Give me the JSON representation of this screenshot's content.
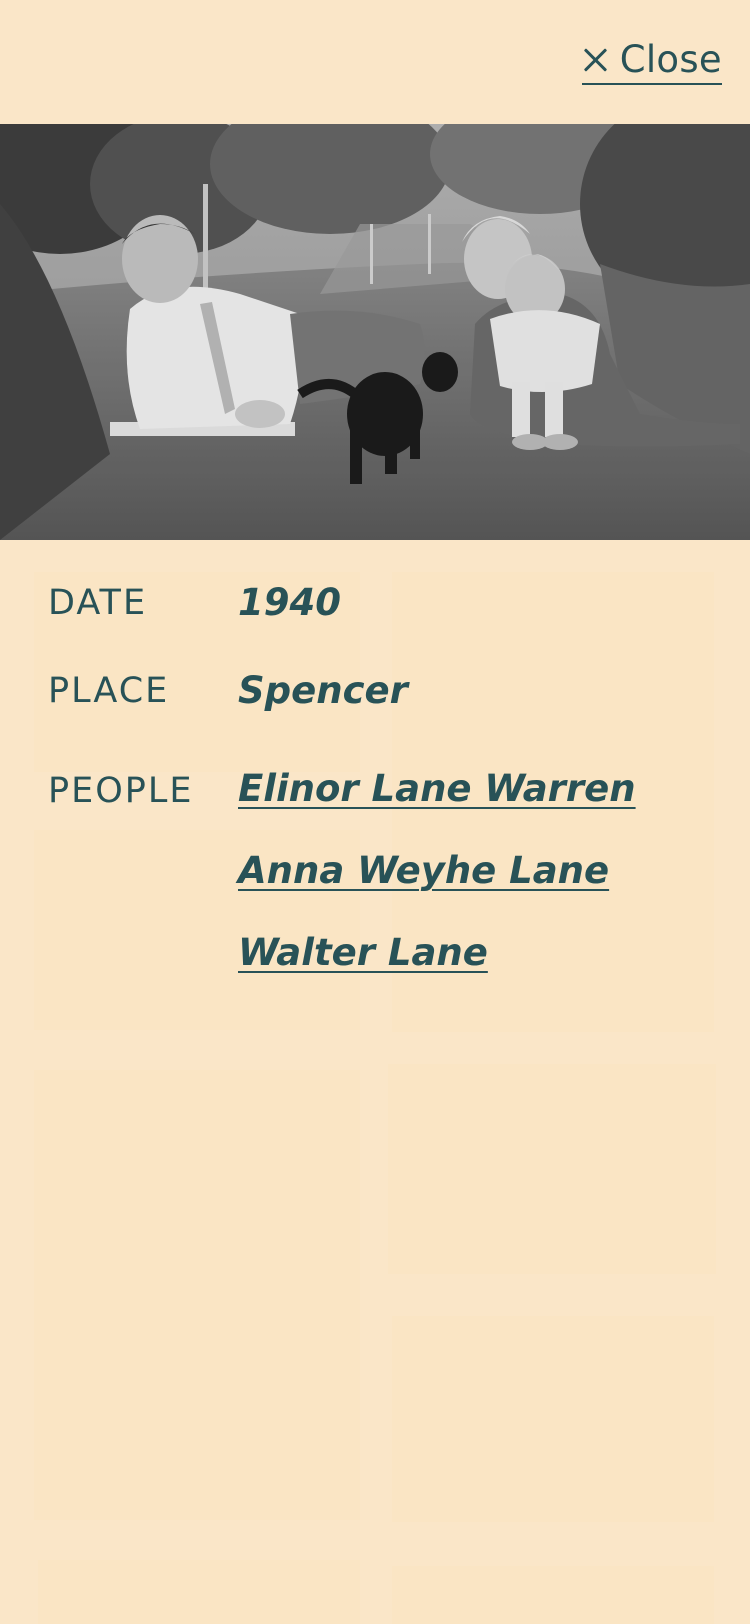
{
  "close": {
    "label": "Close",
    "icon": "close-icon"
  },
  "photo": {
    "alt": "",
    "colors": {
      "sky": "#8a8a8a",
      "grass": "#5f5f5f"
    }
  },
  "details": {
    "date_label": "DATE",
    "date_value": "1940",
    "place_label": "PLACE",
    "place_value": "Spencer",
    "people_label": "PEOPLE",
    "people": [
      "Elinor Lane Warren",
      "Anna Weyhe Lane",
      "Walter Lane"
    ]
  },
  "colors": {
    "background": "#fae6c8",
    "text": "#285257"
  }
}
